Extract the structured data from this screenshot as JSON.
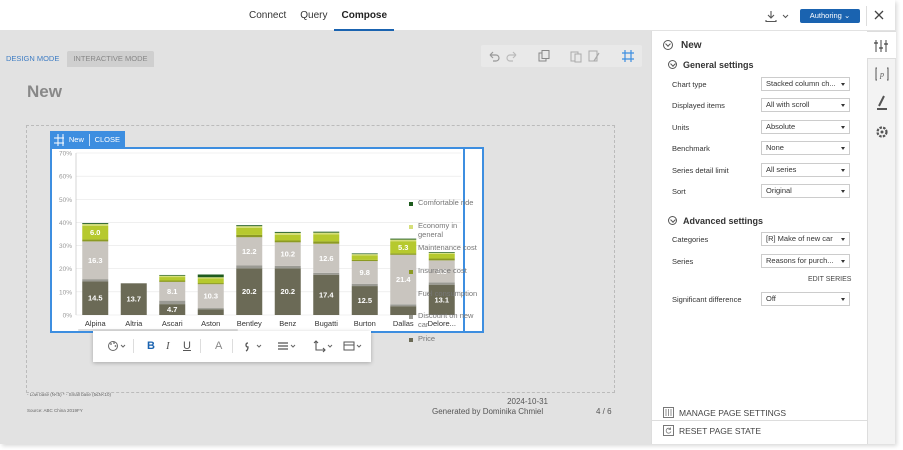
{
  "topbar": {
    "tabs": [
      "Connect",
      "Query",
      "Compose"
    ],
    "active_tab": "Compose",
    "authoring_label": "Authoring"
  },
  "canvas": {
    "modes": [
      "DESIGN MODE",
      "INTERACTIVE MODE"
    ],
    "page_title": "New",
    "footer_note1": "- Low base (N<5)  * - Small base (5≤N<10)",
    "footer_note2": "Source: ABC China 2019FY",
    "footer_date": "2024-10-31",
    "footer_generated": "Generated by Dominika Chmiel",
    "footer_page": "4 / 6"
  },
  "chart_widget": {
    "tab_label": "New",
    "close_label": "CLOSE"
  },
  "chart_data": {
    "type": "bar",
    "stacked": true,
    "categories": [
      "Alpina",
      "Altria",
      "Ascari",
      "Aston",
      "Bentley",
      "Benz",
      "Bugatti",
      "Burton",
      "Dallas",
      "Delore..."
    ],
    "ylim": [
      0,
      70
    ],
    "yticks": [
      "0%",
      "10%",
      "20%",
      "30%",
      "40%",
      "50%",
      "60%",
      "70%"
    ],
    "grid": true,
    "legend_position": "right",
    "series": [
      {
        "name": "Price",
        "color": "#6b6a56",
        "values": [
          14.5,
          13.7,
          4.7,
          2.5,
          20.2,
          20.2,
          17.4,
          12.5,
          3.8,
          13.1
        ],
        "labels": [
          "14.5",
          "13.7",
          "4.7",
          "",
          "20.2",
          "20.2",
          "17.4",
          "12.5",
          "",
          "13.1"
        ]
      },
      {
        "name": "Discount on new car",
        "color": "#9a9a93",
        "values": [
          1.0,
          0,
          1.5,
          0.5,
          1.2,
          1.0,
          0.8,
          1.0,
          0.8,
          1.0
        ],
        "labels": [
          "",
          "",
          "",
          "",
          "",
          "",
          "",
          "",
          "",
          ""
        ]
      },
      {
        "name": "Fuel consumption",
        "color": "#c9c5bf",
        "values": [
          16.3,
          0,
          8.1,
          10.3,
          12.2,
          10.2,
          12.6,
          9.8,
          21.4,
          9.5
        ],
        "labels": [
          "16.3",
          "",
          "8.1",
          "10.3",
          "12.2",
          "10.2",
          "12.6",
          "9.8",
          "21.4",
          "9.5"
        ]
      },
      {
        "name": "Insurance cost",
        "color": "#8c9a23",
        "values": [
          0.8,
          0,
          0.6,
          0.5,
          1.0,
          0.8,
          1.0,
          0.5,
          0.6,
          0.8
        ],
        "labels": [
          "",
          "",
          "",
          "",
          "",
          "",
          "",
          "",
          "",
          ""
        ]
      },
      {
        "name": "Maintenance cost",
        "color": "#b6c92e",
        "values": [
          6.0,
          0,
          1.5,
          2.0,
          3.0,
          2.5,
          3.0,
          2.0,
          5.3,
          2.0
        ],
        "labels": [
          "6.0",
          "",
          "",
          "",
          "",
          "",
          "",
          "",
          "5.3",
          ""
        ]
      },
      {
        "name": "Economy in general",
        "color": "#d6df7a",
        "values": [
          0.7,
          0,
          0.6,
          0.5,
          0.8,
          0.8,
          0.8,
          0.5,
          0.7,
          0.5
        ],
        "labels": [
          "",
          "",
          "",
          "",
          "",
          "",
          "",
          "",
          "",
          ""
        ]
      },
      {
        "name": "Comfortable ride",
        "color": "#1e5b1e",
        "values": [
          0.4,
          0,
          0.3,
          1.2,
          0.4,
          0.4,
          0.4,
          0.3,
          0.4,
          0.3
        ],
        "labels": [
          "",
          "",
          "",
          "",
          "",
          "",
          "",
          "",
          "",
          ""
        ]
      }
    ]
  },
  "legend": {
    "items": [
      {
        "label": "Comfortable ride",
        "color": "#1e5b1e"
      },
      {
        "label": "Economy in general",
        "color": "#d6df7a"
      },
      {
        "label": "Maintenance cost",
        "color": "#b6c92e"
      },
      {
        "label": "Insurance cost",
        "color": "#8c9a23"
      },
      {
        "label": "Fuel consumption",
        "color": "#c9c5bf"
      },
      {
        "label": "Discount on new car",
        "color": "#9a9a93"
      },
      {
        "label": "Price",
        "color": "#6b6a56"
      }
    ]
  },
  "format_toolbar": {
    "bold": "B",
    "italic": "I",
    "underline": "U",
    "font_color": "A"
  },
  "panel": {
    "title": "New",
    "general_settings": "General settings",
    "fields": [
      {
        "label": "Chart type",
        "value": "Stacked column ch..."
      },
      {
        "label": "Displayed items",
        "value": "All with scroll"
      },
      {
        "label": "Units",
        "value": "Absolute"
      },
      {
        "label": "Benchmark",
        "value": "None"
      },
      {
        "label": "Series detail limit",
        "value": "All series"
      },
      {
        "label": "Sort",
        "value": "Original"
      }
    ],
    "advanced_settings": "Advanced settings",
    "adv_fields": [
      {
        "label": "Categories",
        "value": "[R] Make of new car"
      },
      {
        "label": "Series",
        "value": "Reasons for purch..."
      }
    ],
    "edit_series": "EDIT SERIES",
    "sig_label": "Significant difference",
    "sig_value": "Off",
    "manage_page_settings": "MANAGE PAGE SETTINGS",
    "reset_page_state": "RESET PAGE STATE"
  }
}
